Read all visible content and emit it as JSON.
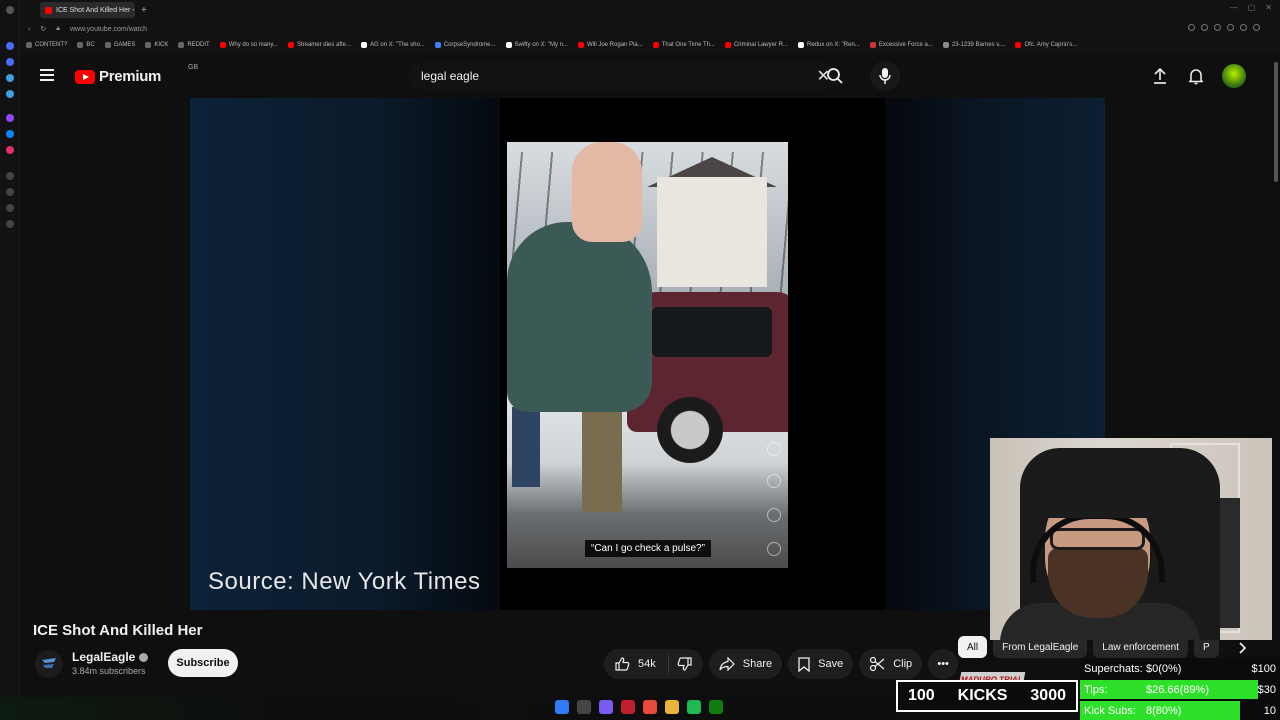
{
  "browser": {
    "tab_title": "ICE Shot And Killed Her -",
    "new_tab": "+",
    "url": "www.youtube.com/watch",
    "bookmarks": [
      "CONTENT?",
      "BC",
      "GAMES",
      "KICK",
      "REDDIT",
      "Why do so many...",
      "Streamer dies afte...",
      "AG on X: \"The sho...",
      "CorpseSyndrome...",
      "Swifty on X: \"My n...",
      "Will Joe Rogan Pla...",
      "That One Time Th...",
      "Criminal Lawyer R...",
      "Redux on X: \"Ren...",
      "Excessive Force a...",
      "23-1239 Barnes v....",
      "Ofc. Amy Caprio's..."
    ]
  },
  "header": {
    "logo_text": "Premium",
    "region": "GB",
    "search_value": "legal eagle",
    "clear_symbol": "✕"
  },
  "player": {
    "caption": "“Can I go check a pulse?”",
    "source_overlay": "Source: New York Times"
  },
  "video": {
    "title": "ICE Shot And Killed Her",
    "channel": "LegalEagle",
    "subscribers": "3.84m subscribers",
    "subscribe_label": "Subscribe",
    "likes": "54k",
    "share_label": "Share",
    "save_label": "Save",
    "clip_label": "Clip",
    "more_label": "•••"
  },
  "chips": [
    "All",
    "From LegalEagle",
    "Law enforcement",
    "P"
  ],
  "overlay": {
    "kicks_left": "100",
    "kicks_label": "KICKS",
    "kicks_right": "3000",
    "badge": "MADURO TRIAL",
    "superchats_label": "Superchats:",
    "superchats_value": "$0(0%)",
    "superchats_goal": "$100",
    "superchats_progress": 0,
    "tips_label": "Tips:",
    "tips_value": "$26.66(89%)",
    "tips_goal": "$30",
    "tips_progress": 0.89,
    "kicksubs_label": "Kick Subs:",
    "kicksubs_value": "8(80%)",
    "kicksubs_goal": "10",
    "kicksubs_progress": 0.8
  }
}
